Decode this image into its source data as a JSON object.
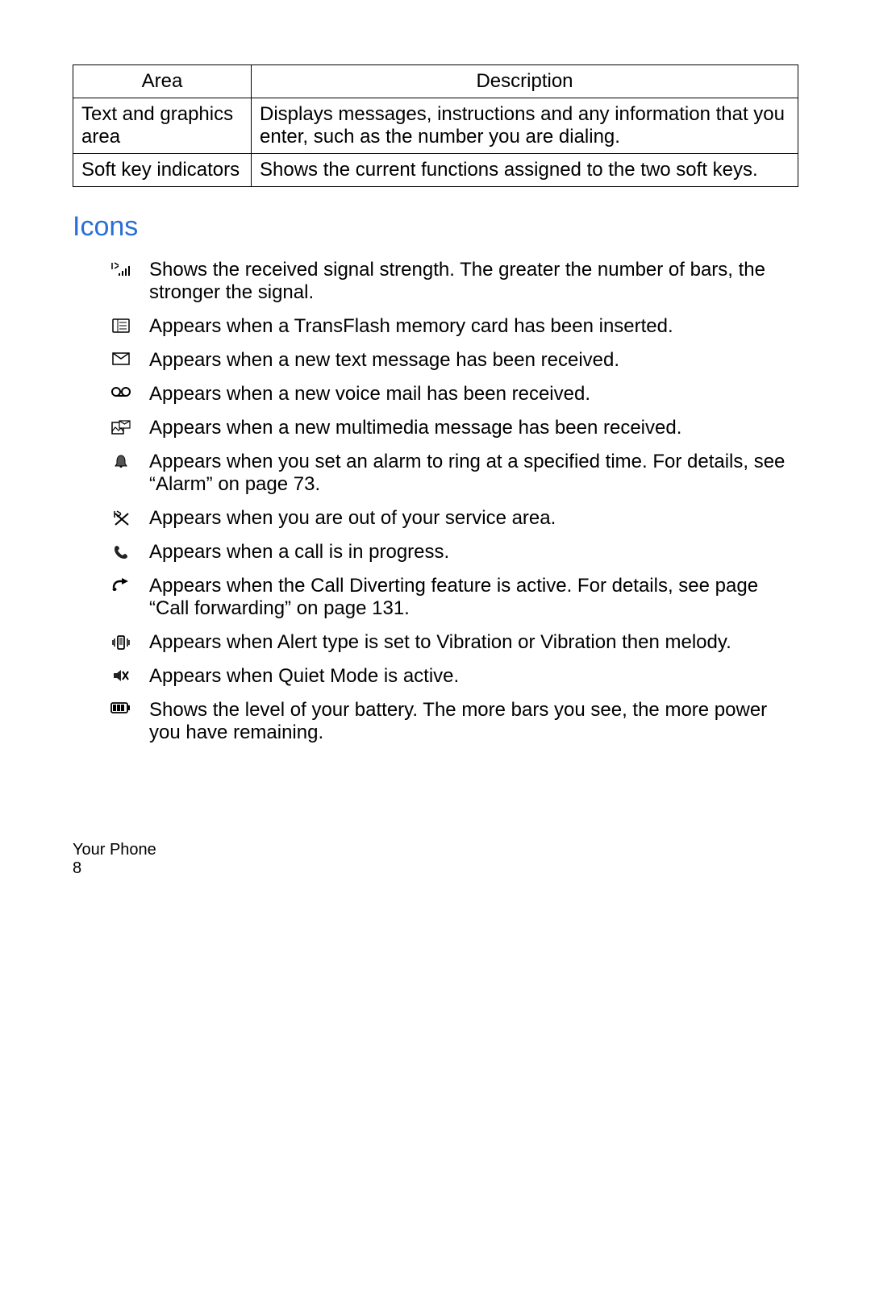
{
  "table": {
    "headers": [
      "Area",
      "Description"
    ],
    "rows": [
      {
        "area": "Text and graphics area",
        "desc": "Displays messages, instructions and any information that you enter, such as the number you are dialing."
      },
      {
        "area": "Soft key indicators",
        "desc": "Shows the current functions assigned to the two soft keys."
      }
    ]
  },
  "section_heading": "Icons",
  "icons": [
    {
      "name": "signal-strength-icon",
      "desc": "Shows the received signal strength. The greater the number of bars, the stronger the signal."
    },
    {
      "name": "memory-card-icon",
      "desc": "Appears when a TransFlash memory card has been inserted."
    },
    {
      "name": "text-message-icon",
      "desc": "Appears when a new text message has been received."
    },
    {
      "name": "voicemail-icon",
      "desc": "Appears when a new voice mail has been received."
    },
    {
      "name": "mms-icon",
      "desc": "Appears when a new multimedia message has been received."
    },
    {
      "name": "alarm-icon",
      "desc": "Appears when you set an alarm to ring at a specified time. For details, see “Alarm” on page 73."
    },
    {
      "name": "no-service-icon",
      "desc": "Appears when you are out of your service area."
    },
    {
      "name": "call-in-progress-icon",
      "desc": "Appears when a call is in progress."
    },
    {
      "name": "call-diverting-icon",
      "desc": "Appears when the Call Diverting feature is active. For details, see page “Call forwarding” on page 131."
    },
    {
      "name": "vibration-icon",
      "desc": "Appears when Alert type is set to Vibration or Vibration then melody."
    },
    {
      "name": "quiet-mode-icon",
      "desc": "Appears when Quiet Mode is active."
    },
    {
      "name": "battery-icon",
      "desc": "Shows the level of your battery. The more bars you see, the more power you have remaining."
    }
  ],
  "footer": {
    "section": "Your Phone",
    "page_number": "8"
  }
}
